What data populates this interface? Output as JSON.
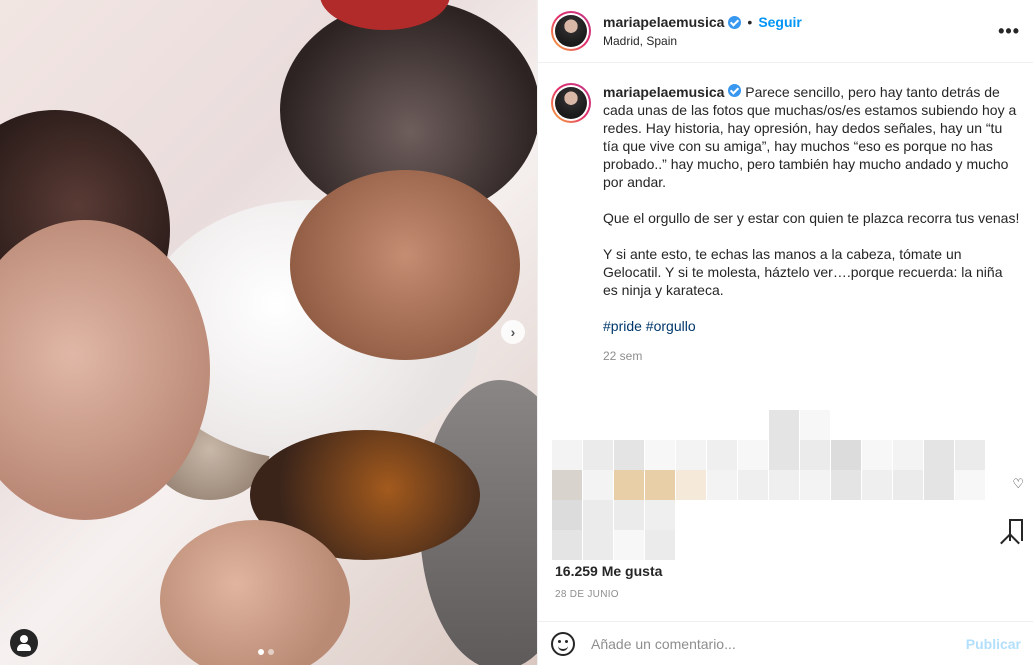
{
  "post": {
    "username": "mariapelaemusica",
    "follow_label": "Seguir",
    "separator": "•",
    "location": "Madrid, Spain",
    "more_icon": "•••",
    "caption_paragraphs": [
      "Parece sencillo, pero hay tanto detrás de cada unas de las fotos que muchas/os/es estamos subiendo hoy a redes. Hay historia, hay opresión, hay dedos señales, hay un “tu tía que vive con su amiga”, hay muchos “eso es porque no has probado..” hay mucho, pero también hay mucho andado y mucho por andar.",
      "Que el orgullo de ser y estar con quien te plazca recorra tus venas!",
      "Y si ante esto, te echas las manos a la cabeza, tómate un Gelocatil. Y si te molesta, háztelo ver….porque recuerda: la niña es ninja y karateca."
    ],
    "hashtags": "#pride #orgullo",
    "time_ago": "22 sem",
    "likes": "16.259 Me gusta",
    "date": "28 DE JUNIO"
  },
  "photo": {
    "next_icon": "›"
  },
  "comment": {
    "placeholder": "Añade un comentario...",
    "publish_label": "Publicar"
  },
  "colors": {
    "accent": "#0095f6",
    "verified": "#3897f0",
    "publish_disabled": "#b2dffc",
    "hashtag": "#00376b"
  }
}
